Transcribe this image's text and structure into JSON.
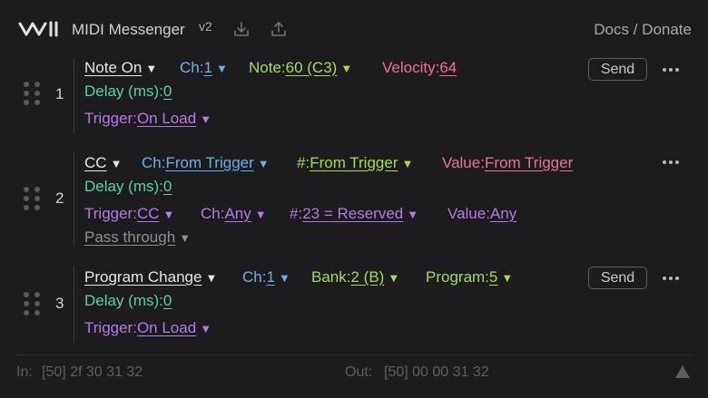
{
  "header": {
    "title": "MIDI Messenger",
    "version": "v2",
    "docs_link": "Docs / Donate"
  },
  "messages": [
    {
      "number": "1",
      "type": "Note On",
      "channel_label": "Ch:",
      "channel_value": "1",
      "note_label": "Note:",
      "note_value": "60 (C3)",
      "velocity_label": "Velocity:",
      "velocity_value": "64",
      "delay_label": "Delay (ms):",
      "delay_value": "0",
      "trigger_label": "Trigger:",
      "trigger_value": "On Load",
      "send_label": "Send"
    },
    {
      "number": "2",
      "type": "CC",
      "channel_label": "Ch:",
      "channel_value": "From Trigger",
      "cc_label": "#:",
      "cc_value": "From Trigger",
      "value_label": "Value:",
      "value_value": "From Trigger",
      "delay_label": "Delay (ms):",
      "delay_value": "0",
      "trigger_label": "Trigger:",
      "trigger_value": "CC",
      "trigger_ch_label": "Ch:",
      "trigger_ch_value": "Any",
      "trigger_num_label": "#:",
      "trigger_num_value": "23 = Reserved",
      "trigger_val_label": "Value:",
      "trigger_val_value": "Any",
      "pass_through": "Pass through"
    },
    {
      "number": "3",
      "type": "Program Change",
      "channel_label": "Ch:",
      "channel_value": "1",
      "bank_label": "Bank:",
      "bank_value": "2 (B)",
      "program_label": "Program:",
      "program_value": "5",
      "delay_label": "Delay (ms):",
      "delay_value": "0",
      "trigger_label": "Trigger:",
      "trigger_value": "On Load",
      "send_label": "Send"
    }
  ],
  "footer": {
    "in_label": "In:",
    "in_value": "[50] 2f 30 31 32",
    "out_label": "Out:",
    "out_value": "[50] 00 00 31 32"
  },
  "colors": {
    "background": "#1c1c1e",
    "channel": "#6ab0e8",
    "param": "#a6dc4c",
    "value": "#e8729a",
    "delay": "#5ad0a8",
    "trigger": "#b47ae6"
  }
}
